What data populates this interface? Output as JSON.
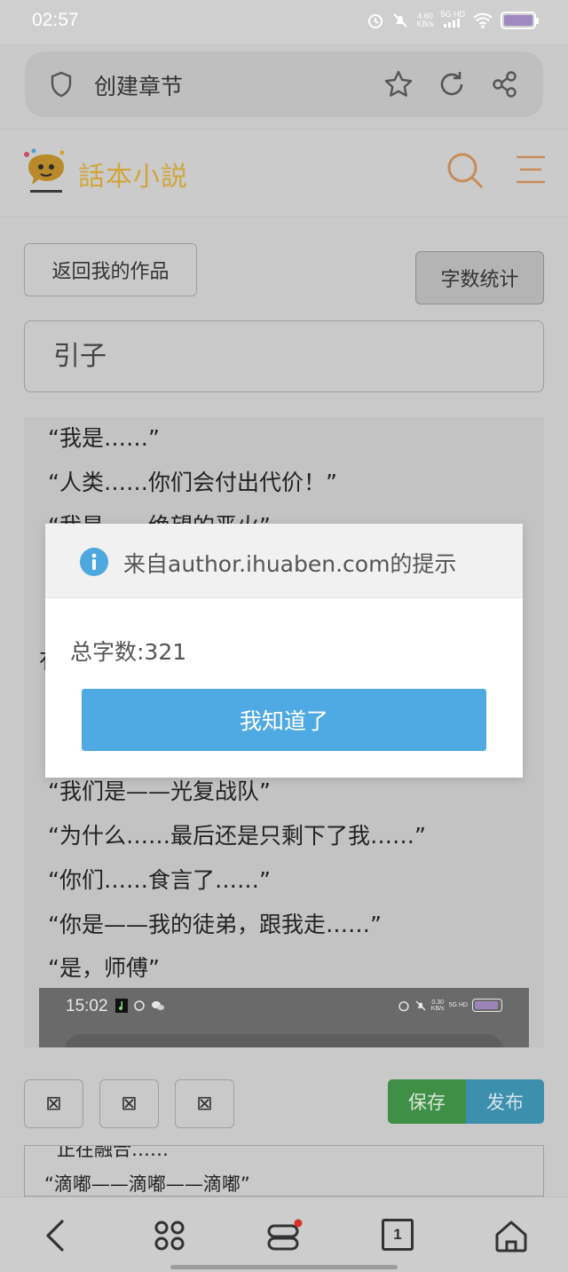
{
  "status_bar": {
    "time": "02:57",
    "net_speed_value": "4.60",
    "net_speed_unit": "KB/s",
    "network": "5G HD"
  },
  "browser": {
    "page_title": "创建章节"
  },
  "site": {
    "logo_text": "話本小説"
  },
  "toolbar": {
    "back_label": "返回我的作品",
    "count_label": "字数统计"
  },
  "chapter": {
    "title_value": "引子"
  },
  "editor": {
    "lines_top": [
      "“我是……”",
      "“人类……你们会付出代价！”",
      "“我是……绝望的恶火”"
    ],
    "stray_char": "有",
    "lines_bottom": [
      "“我们是——光复战队”",
      "“为什么……最后还是只剩下了我……”",
      "“你们……食言了……”",
      "“你是——我的徒弟，跟我走……”",
      "“是，师傅”"
    ],
    "embedded_screenshot": {
      "time": "15:02",
      "net_speed_value": "0.30",
      "net_speed_unit": "KB/s",
      "network": "5G HD"
    }
  },
  "format_buttons": [
    "⊠",
    "⊠",
    "⊠"
  ],
  "actions": {
    "save_label": "保存",
    "publish_label": "发布"
  },
  "preview": {
    "line1": "正在融合……",
    "line2": "“滴嘟——滴嘟——滴嘟”"
  },
  "dialog": {
    "title": "来自author.ihuaben.com的提示",
    "message": "总字数:321",
    "ok_label": "我知道了"
  },
  "bottom_nav": {
    "tab_count": "1"
  },
  "colors": {
    "dialog_button": "#4fa9e3",
    "save_button": "#3f8f47",
    "publish_button": "#3d8fae",
    "logo": "#d1a53c",
    "site_icons": "#c98b57"
  }
}
